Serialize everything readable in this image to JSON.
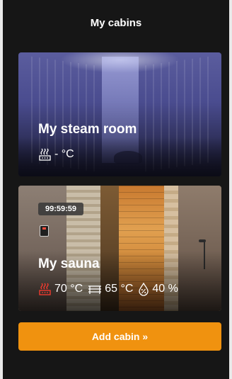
{
  "header": {
    "title": "My cabins"
  },
  "cabins": [
    {
      "name": "My steam room",
      "heater_reading": "- °C",
      "heater_icon": "heater-off-icon"
    },
    {
      "name": "My sauna",
      "timer": "99:59:59",
      "control_panel_icon": "control-panel-icon",
      "heater_reading": "70 °C",
      "bench_reading": "65 °C",
      "humidity_reading": "40 %",
      "heater_icon": "heater-on-icon",
      "bench_icon": "bench-temperature-icon",
      "humidity_icon": "humidity-icon"
    }
  ],
  "actions": {
    "add_cabin_label": "Add cabin »"
  },
  "colors": {
    "background": "#161616",
    "accent": "#f0920f",
    "heater_active": "#ff3b2f",
    "text": "#ffffff"
  }
}
